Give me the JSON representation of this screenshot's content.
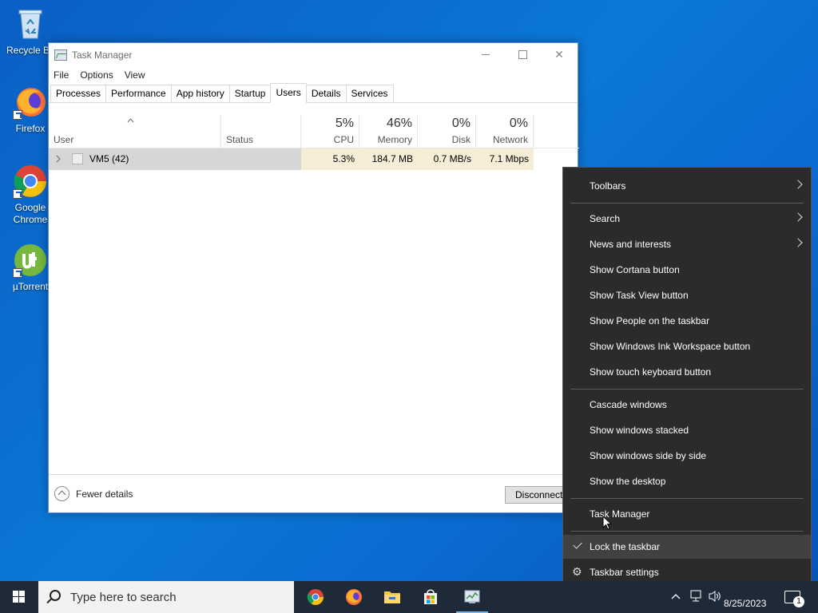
{
  "desktop": {
    "icons": [
      {
        "label": "Recycle Bin",
        "icon": "recycle-bin-icon"
      },
      {
        "label": "Firefox",
        "icon": "firefox-icon"
      },
      {
        "label": "Google Chrome",
        "icon": "chrome-icon"
      },
      {
        "label": "µTorrent",
        "icon": "utorrent-icon"
      }
    ]
  },
  "task_manager": {
    "title": "Task Manager",
    "menu": [
      "File",
      "Options",
      "View"
    ],
    "tabs": [
      "Processes",
      "Performance",
      "App history",
      "Startup",
      "Users",
      "Details",
      "Services"
    ],
    "active_tab": "Users",
    "columns": {
      "user": "User",
      "status": "Status",
      "cpu": {
        "pct": "5%",
        "label": "CPU"
      },
      "memory": {
        "pct": "46%",
        "label": "Memory"
      },
      "disk": {
        "pct": "0%",
        "label": "Disk"
      },
      "network": {
        "pct": "0%",
        "label": "Network"
      }
    },
    "rows": [
      {
        "user": "VM5 (42)",
        "status": "",
        "cpu": "5.3%",
        "memory": "184.7 MB",
        "disk": "0.7 MB/s",
        "network": "7.1 Mbps"
      }
    ],
    "footer": {
      "fewer_details": "Fewer details",
      "disconnect": "Disconnect"
    }
  },
  "context_menu": {
    "items": [
      {
        "label": "Toolbars",
        "submenu": true
      },
      {
        "label": "Search",
        "submenu": true
      },
      {
        "label": "News and interests",
        "submenu": true
      },
      {
        "label": "Show Cortana button"
      },
      {
        "label": "Show Task View button"
      },
      {
        "label": "Show People on the taskbar"
      },
      {
        "label": "Show Windows Ink Workspace button"
      },
      {
        "label": "Show touch keyboard button"
      },
      {
        "label": "Cascade windows"
      },
      {
        "label": "Show windows stacked"
      },
      {
        "label": "Show windows side by side"
      },
      {
        "label": "Show the desktop"
      },
      {
        "label": "Task Manager"
      },
      {
        "label": "Lock the taskbar",
        "checked": true
      },
      {
        "label": "Taskbar settings",
        "icon": "gear-icon"
      }
    ]
  },
  "taskbar": {
    "search_placeholder": "Type here to search",
    "apps": [
      "chrome-icon",
      "firefox-icon",
      "file-explorer-icon",
      "microsoft-store-icon",
      "task-manager-icon"
    ],
    "date": "8/25/2023",
    "notifications": "1"
  }
}
